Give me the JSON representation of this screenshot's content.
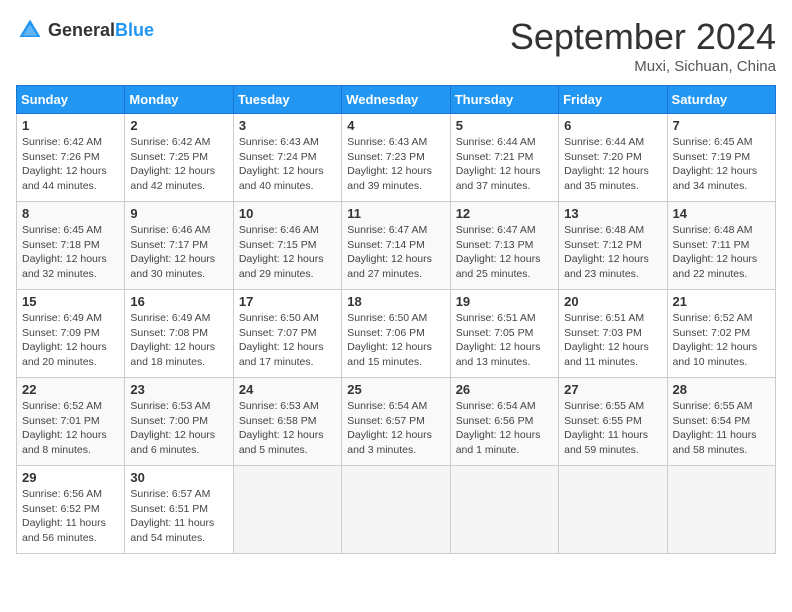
{
  "header": {
    "logo": {
      "text1": "General",
      "text2": "Blue"
    },
    "title": "September 2024",
    "location": "Muxi, Sichuan, China"
  },
  "weekdays": [
    "Sunday",
    "Monday",
    "Tuesday",
    "Wednesday",
    "Thursday",
    "Friday",
    "Saturday"
  ],
  "weeks": [
    [
      {
        "day": "1",
        "sunrise": "Sunrise: 6:42 AM",
        "sunset": "Sunset: 7:26 PM",
        "daylight": "Daylight: 12 hours and 44 minutes."
      },
      {
        "day": "2",
        "sunrise": "Sunrise: 6:42 AM",
        "sunset": "Sunset: 7:25 PM",
        "daylight": "Daylight: 12 hours and 42 minutes."
      },
      {
        "day": "3",
        "sunrise": "Sunrise: 6:43 AM",
        "sunset": "Sunset: 7:24 PM",
        "daylight": "Daylight: 12 hours and 40 minutes."
      },
      {
        "day": "4",
        "sunrise": "Sunrise: 6:43 AM",
        "sunset": "Sunset: 7:23 PM",
        "daylight": "Daylight: 12 hours and 39 minutes."
      },
      {
        "day": "5",
        "sunrise": "Sunrise: 6:44 AM",
        "sunset": "Sunset: 7:21 PM",
        "daylight": "Daylight: 12 hours and 37 minutes."
      },
      {
        "day": "6",
        "sunrise": "Sunrise: 6:44 AM",
        "sunset": "Sunset: 7:20 PM",
        "daylight": "Daylight: 12 hours and 35 minutes."
      },
      {
        "day": "7",
        "sunrise": "Sunrise: 6:45 AM",
        "sunset": "Sunset: 7:19 PM",
        "daylight": "Daylight: 12 hours and 34 minutes."
      }
    ],
    [
      {
        "day": "8",
        "sunrise": "Sunrise: 6:45 AM",
        "sunset": "Sunset: 7:18 PM",
        "daylight": "Daylight: 12 hours and 32 minutes."
      },
      {
        "day": "9",
        "sunrise": "Sunrise: 6:46 AM",
        "sunset": "Sunset: 7:17 PM",
        "daylight": "Daylight: 12 hours and 30 minutes."
      },
      {
        "day": "10",
        "sunrise": "Sunrise: 6:46 AM",
        "sunset": "Sunset: 7:15 PM",
        "daylight": "Daylight: 12 hours and 29 minutes."
      },
      {
        "day": "11",
        "sunrise": "Sunrise: 6:47 AM",
        "sunset": "Sunset: 7:14 PM",
        "daylight": "Daylight: 12 hours and 27 minutes."
      },
      {
        "day": "12",
        "sunrise": "Sunrise: 6:47 AM",
        "sunset": "Sunset: 7:13 PM",
        "daylight": "Daylight: 12 hours and 25 minutes."
      },
      {
        "day": "13",
        "sunrise": "Sunrise: 6:48 AM",
        "sunset": "Sunset: 7:12 PM",
        "daylight": "Daylight: 12 hours and 23 minutes."
      },
      {
        "day": "14",
        "sunrise": "Sunrise: 6:48 AM",
        "sunset": "Sunset: 7:11 PM",
        "daylight": "Daylight: 12 hours and 22 minutes."
      }
    ],
    [
      {
        "day": "15",
        "sunrise": "Sunrise: 6:49 AM",
        "sunset": "Sunset: 7:09 PM",
        "daylight": "Daylight: 12 hours and 20 minutes."
      },
      {
        "day": "16",
        "sunrise": "Sunrise: 6:49 AM",
        "sunset": "Sunset: 7:08 PM",
        "daylight": "Daylight: 12 hours and 18 minutes."
      },
      {
        "day": "17",
        "sunrise": "Sunrise: 6:50 AM",
        "sunset": "Sunset: 7:07 PM",
        "daylight": "Daylight: 12 hours and 17 minutes."
      },
      {
        "day": "18",
        "sunrise": "Sunrise: 6:50 AM",
        "sunset": "Sunset: 7:06 PM",
        "daylight": "Daylight: 12 hours and 15 minutes."
      },
      {
        "day": "19",
        "sunrise": "Sunrise: 6:51 AM",
        "sunset": "Sunset: 7:05 PM",
        "daylight": "Daylight: 12 hours and 13 minutes."
      },
      {
        "day": "20",
        "sunrise": "Sunrise: 6:51 AM",
        "sunset": "Sunset: 7:03 PM",
        "daylight": "Daylight: 12 hours and 11 minutes."
      },
      {
        "day": "21",
        "sunrise": "Sunrise: 6:52 AM",
        "sunset": "Sunset: 7:02 PM",
        "daylight": "Daylight: 12 hours and 10 minutes."
      }
    ],
    [
      {
        "day": "22",
        "sunrise": "Sunrise: 6:52 AM",
        "sunset": "Sunset: 7:01 PM",
        "daylight": "Daylight: 12 hours and 8 minutes."
      },
      {
        "day": "23",
        "sunrise": "Sunrise: 6:53 AM",
        "sunset": "Sunset: 7:00 PM",
        "daylight": "Daylight: 12 hours and 6 minutes."
      },
      {
        "day": "24",
        "sunrise": "Sunrise: 6:53 AM",
        "sunset": "Sunset: 6:58 PM",
        "daylight": "Daylight: 12 hours and 5 minutes."
      },
      {
        "day": "25",
        "sunrise": "Sunrise: 6:54 AM",
        "sunset": "Sunset: 6:57 PM",
        "daylight": "Daylight: 12 hours and 3 minutes."
      },
      {
        "day": "26",
        "sunrise": "Sunrise: 6:54 AM",
        "sunset": "Sunset: 6:56 PM",
        "daylight": "Daylight: 12 hours and 1 minute."
      },
      {
        "day": "27",
        "sunrise": "Sunrise: 6:55 AM",
        "sunset": "Sunset: 6:55 PM",
        "daylight": "Daylight: 11 hours and 59 minutes."
      },
      {
        "day": "28",
        "sunrise": "Sunrise: 6:55 AM",
        "sunset": "Sunset: 6:54 PM",
        "daylight": "Daylight: 11 hours and 58 minutes."
      }
    ],
    [
      {
        "day": "29",
        "sunrise": "Sunrise: 6:56 AM",
        "sunset": "Sunset: 6:52 PM",
        "daylight": "Daylight: 11 hours and 56 minutes."
      },
      {
        "day": "30",
        "sunrise": "Sunrise: 6:57 AM",
        "sunset": "Sunset: 6:51 PM",
        "daylight": "Daylight: 11 hours and 54 minutes."
      },
      null,
      null,
      null,
      null,
      null
    ]
  ]
}
